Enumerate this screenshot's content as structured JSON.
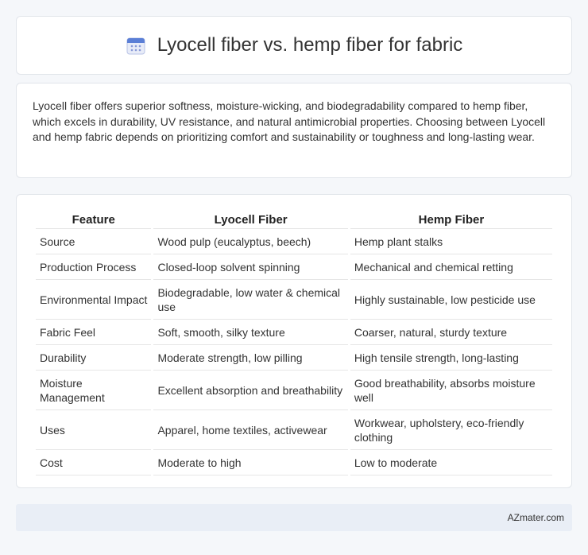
{
  "header": {
    "title": "Lyocell fiber vs. hemp fiber for fabric",
    "icon": "calendar-icon"
  },
  "summary": "Lyocell fiber offers superior softness, moisture-wicking, and biodegradability compared to hemp fiber, which excels in durability, UV resistance, and natural antimicrobial properties. Choosing between Lyocell and hemp fabric depends on prioritizing comfort and sustainability or toughness and long-lasting wear.",
  "table": {
    "columns": [
      "Feature",
      "Lyocell Fiber",
      "Hemp Fiber"
    ],
    "rows": [
      [
        "Source",
        "Wood pulp (eucalyptus, beech)",
        "Hemp plant stalks"
      ],
      [
        "Production Process",
        "Closed-loop solvent spinning",
        "Mechanical and chemical retting"
      ],
      [
        "Environmental Impact",
        "Biodegradable, low water & chemical use",
        "Highly sustainable, low pesticide use"
      ],
      [
        "Fabric Feel",
        "Soft, smooth, silky texture",
        "Coarser, natural, sturdy texture"
      ],
      [
        "Durability",
        "Moderate strength, low pilling",
        "High tensile strength, long-lasting"
      ],
      [
        "Moisture Management",
        "Excellent absorption and breathability",
        "Good breathability, absorbs moisture well"
      ],
      [
        "Uses",
        "Apparel, home textiles, activewear",
        "Workwear, upholstery, eco-friendly clothing"
      ],
      [
        "Cost",
        "Moderate to high",
        "Low to moderate"
      ]
    ]
  },
  "footer": {
    "text": "AZmater.com"
  }
}
